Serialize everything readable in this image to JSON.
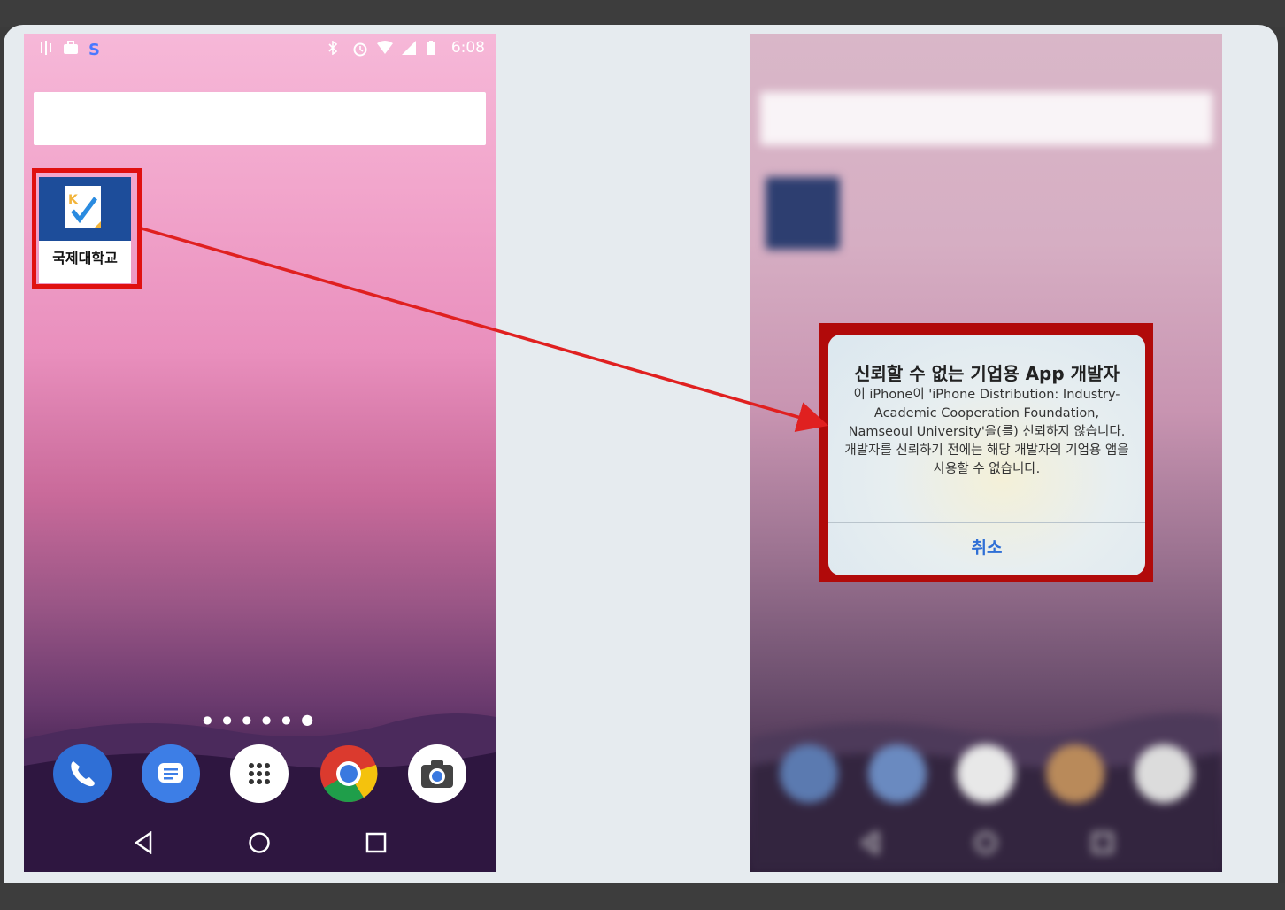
{
  "left_phone": {
    "status_time": "6:08",
    "app_label": "국제대학교",
    "page_dots": "● ● ● ● ● ⬤"
  },
  "right_phone": {
    "alert": {
      "title": "신뢰할 수 없는 기업용 App 개발자",
      "body": "이 iPhone이 'iPhone Distribution: Industry-Academic Cooperation Foundation, Namseoul University'을(를) 신뢰하지 않습니다. 개발자를 신뢰하기 전에는 해당 개발자의 기업용 앱을 사용할 수 없습니다.",
      "cancel_label": "취소"
    }
  },
  "colors": {
    "highlight": "#e01010",
    "arrow": "#e02020",
    "alert_button": "#2f6fd6"
  }
}
